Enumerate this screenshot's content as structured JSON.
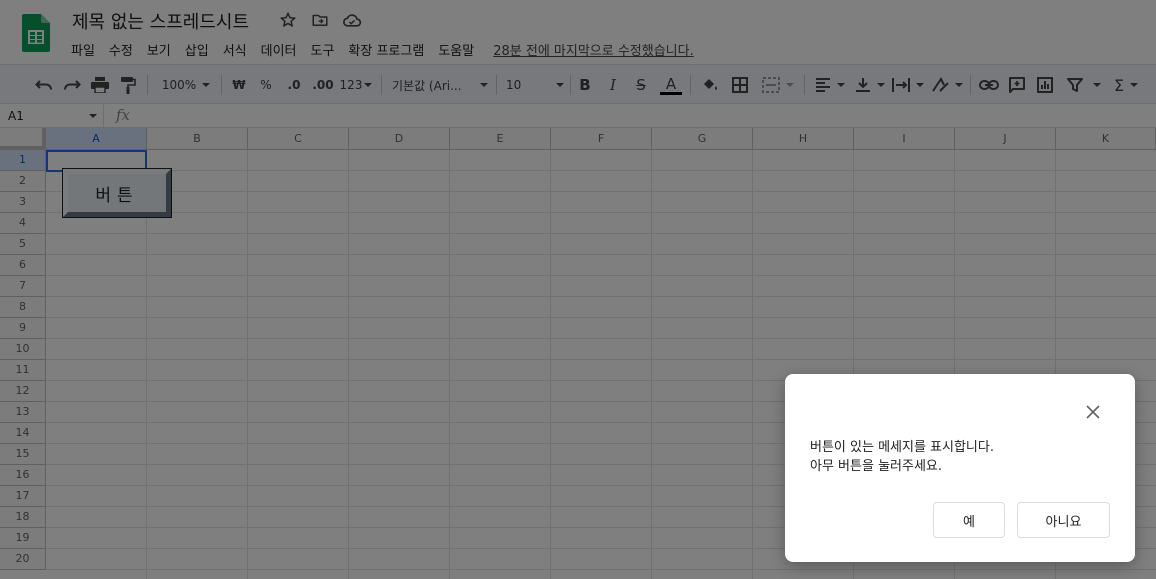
{
  "doc": {
    "title": "제목 없는 스프레드시트",
    "last_edit": "28분 전에 마지막으로 수정했습니다."
  },
  "menu": [
    "파일",
    "수정",
    "보기",
    "삽입",
    "서식",
    "데이터",
    "도구",
    "확장 프로그램",
    "도움말"
  ],
  "toolbar": {
    "zoom": "100%",
    "currency": "₩",
    "percent": "%",
    "decimal_decrease": ".0",
    "decimal_increase": ".00",
    "number_format": "123",
    "font": "기본값 (Ari...",
    "font_size": "10",
    "bold": "B",
    "italic": "I",
    "strike": "S",
    "text_color_glyph": "A",
    "sum_glyph": "Σ"
  },
  "formula_bar": {
    "cell_ref": "A1",
    "fx": "fx"
  },
  "columns": [
    "A",
    "B",
    "C",
    "D",
    "E",
    "F",
    "G",
    "H",
    "I",
    "J",
    "K"
  ],
  "rows": [
    "1",
    "2",
    "3",
    "4",
    "5",
    "6",
    "7",
    "8",
    "9",
    "10",
    "11",
    "12",
    "13",
    "14",
    "15",
    "16",
    "17",
    "18",
    "19",
    "20"
  ],
  "sheet_button": {
    "label": "버튼"
  },
  "dialog": {
    "line1": "버튼이 있는 메세지를 표시합니다.",
    "line2": "아무 버튼을 눌러주세요.",
    "yes": "예",
    "no": "아니요"
  },
  "colors": {
    "sheets_green": "#0f9d58",
    "selection_blue": "#1a73e8",
    "overlay": "rgba(0,0,0,0.5)"
  }
}
